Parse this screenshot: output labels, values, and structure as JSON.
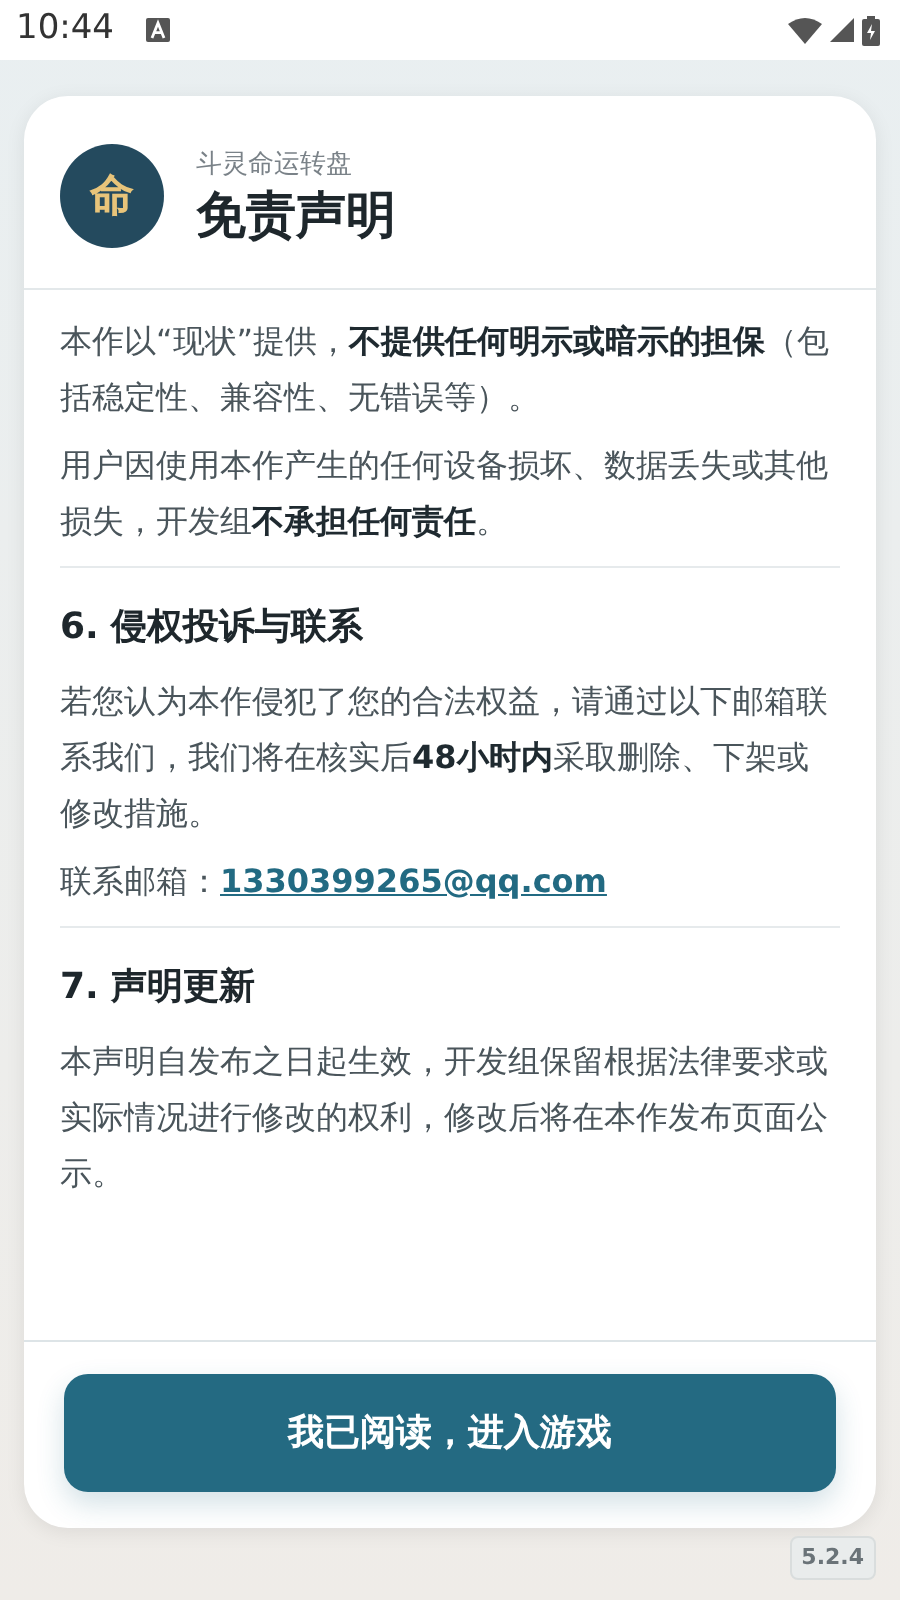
{
  "status_bar": {
    "time": "10:44"
  },
  "header": {
    "app_name": "斗灵命运转盘",
    "title": "免责声明",
    "logo_char": "命"
  },
  "content": [
    {
      "kind": "paragraph",
      "text": "本作以“现状”提供，**不提供任何明示或暗示的担保**（包括稳定性、兼容性、无错误等）。"
    },
    {
      "kind": "paragraph",
      "text": "用户因使用本作产生的任何设备损坏、数据丢失或其他损失，开发组**不承担任何责任**。"
    },
    {
      "kind": "divider"
    },
    {
      "kind": "heading",
      "text": "6. 侵权投诉与联系"
    },
    {
      "kind": "paragraph",
      "text": "若您认为本作侵犯了您的合法权益，请通过以下邮箱联系我们，我们将在核实后**48小时内**采取删除、下架或修改措施。"
    },
    {
      "kind": "contact",
      "label": "联系邮箱：",
      "link": "1330399265@qq.com"
    },
    {
      "kind": "divider"
    },
    {
      "kind": "heading",
      "text": "7. 声明更新"
    },
    {
      "kind": "paragraph",
      "text": "本声明自发布之日起生效，开发组保留根据法律要求或实际情况进行修改的权利，修改后将在本作发布页面公示。"
    }
  ],
  "button": {
    "label": "我已阅读，进入游戏"
  },
  "version": "5.2.4"
}
